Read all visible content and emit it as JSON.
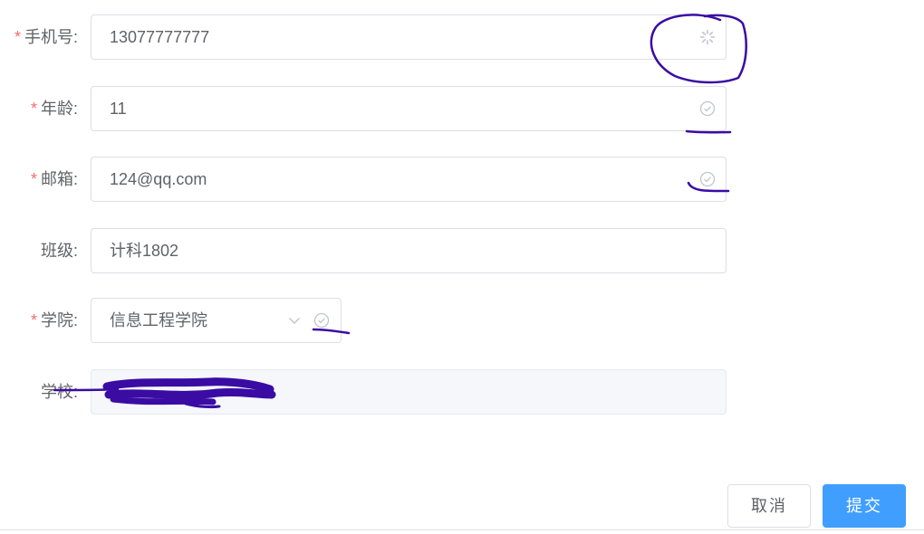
{
  "form": {
    "phone": {
      "label": "手机号:",
      "required": "*",
      "value": "13077777777",
      "status_icon": "loading-icon"
    },
    "age": {
      "label": "年龄:",
      "required": "*",
      "value": "11",
      "status_icon": "check-circle-icon"
    },
    "email": {
      "label": "邮箱:",
      "required": "*",
      "value": "124@qq.com",
      "status_icon": "check-circle-icon"
    },
    "class": {
      "label": "班级:",
      "value": "计科1802"
    },
    "college": {
      "label": "学院:",
      "required": "*",
      "value": "信息工程学院",
      "dropdown_icon": "chevron-down-icon",
      "status_icon": "check-circle-icon"
    },
    "school": {
      "label": "学校:",
      "value": ""
    }
  },
  "footer": {
    "cancel_label": "取消",
    "submit_label": "提交"
  },
  "colors": {
    "required": "#f56c6c",
    "primary": "#409eff",
    "annotation": "#3a0ca3"
  }
}
